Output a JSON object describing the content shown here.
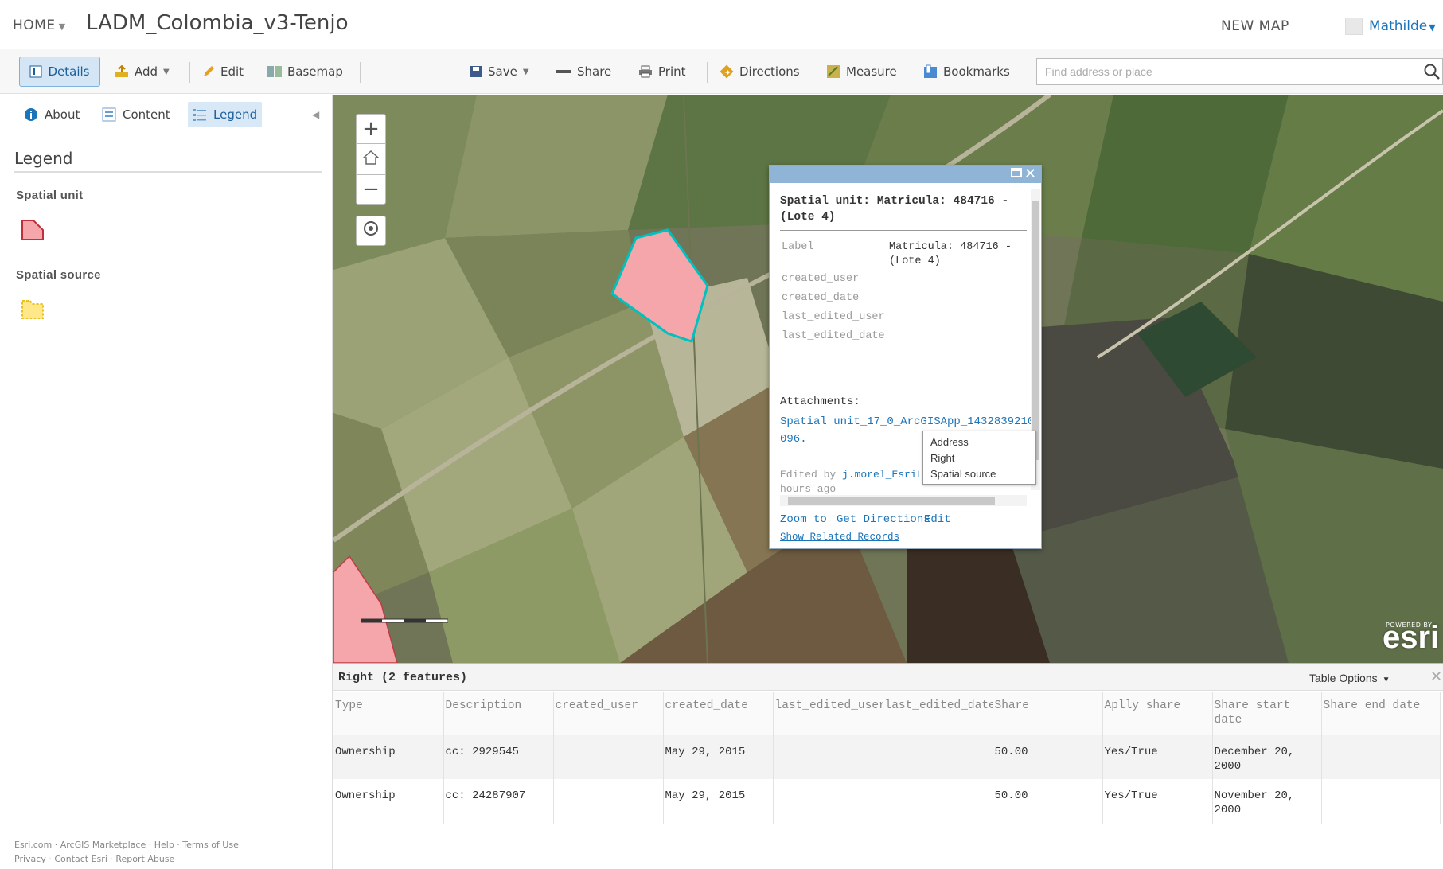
{
  "header": {
    "home_label": "HOME",
    "map_title": "LADM_Colombia_v3-Tenjo",
    "new_map_label": "NEW MAP",
    "user_name": "Mathilde"
  },
  "toolbar": {
    "details": "Details",
    "add": "Add",
    "edit": "Edit",
    "basemap": "Basemap",
    "save": "Save",
    "share": "Share",
    "print": "Print",
    "directions": "Directions",
    "measure": "Measure",
    "bookmarks": "Bookmarks",
    "search_placeholder": "Find address or place"
  },
  "sidepanel": {
    "tabs": [
      {
        "label": "About",
        "icon": "info-icon"
      },
      {
        "label": "Content",
        "icon": "content-icon"
      },
      {
        "label": "Legend",
        "icon": "legend-icon"
      }
    ],
    "legend_heading": "Legend",
    "layers": [
      {
        "name": "Spatial unit",
        "symbol": "pink-polygon",
        "color": "#f4a6aa"
      },
      {
        "name": "Spatial source",
        "symbol": "yellow-dashed-polygon",
        "color": "#ffe36b"
      }
    ],
    "footer_line1": "Esri.com · ArcGIS Marketplace · Help · Terms of Use",
    "footer_line2": "Privacy · Contact Esri · Report Abuse"
  },
  "popup": {
    "title": "Spatial unit: Matricula: 484716 - (Lote 4)",
    "fields": [
      {
        "label": "Label",
        "value": "Matricula: 484716 - (Lote 4)"
      },
      {
        "label": "created_user",
        "value": ""
      },
      {
        "label": "created_date",
        "value": ""
      },
      {
        "label": "last_edited_user",
        "value": ""
      },
      {
        "label": "last_edited_date",
        "value": ""
      }
    ],
    "attachments_label": "Attachments:",
    "attachment_link": "Spatial unit_17_0_ArcGISApp_1432839210096.",
    "edited_prefix": "Edited by",
    "edited_by": "j.morel_EsriLandInternal",
    "edited_suffix": "23 hours ago",
    "actions": [
      "Zoom to",
      "Get Directions",
      "Edit"
    ],
    "show_related": "Show Related Records",
    "related_items": [
      "Address",
      "Right",
      "Spatial source"
    ]
  },
  "map": {
    "logo": "esri",
    "powered_by": "POWERED BY",
    "feature_color": "#f4a6aa",
    "highlight_color": "#00c0c0"
  },
  "table": {
    "title": "Right (2 features)",
    "options_label": "Table Options",
    "columns": [
      "Type",
      "Description",
      "created_user",
      "created_date",
      "last_edited_user",
      "last_edited_date",
      "Share",
      "Aplly share",
      "Share start date",
      "Share end date"
    ],
    "rows": [
      [
        "Ownership",
        "cc: 2929545",
        "",
        "May 29, 2015",
        "",
        "",
        "50.00",
        "Yes/True",
        "December 20, 2000",
        ""
      ],
      [
        "Ownership",
        "cc: 24287907",
        "",
        "May 29, 2015",
        "",
        "",
        "50.00",
        "Yes/True",
        "November 20, 2000",
        ""
      ]
    ]
  }
}
